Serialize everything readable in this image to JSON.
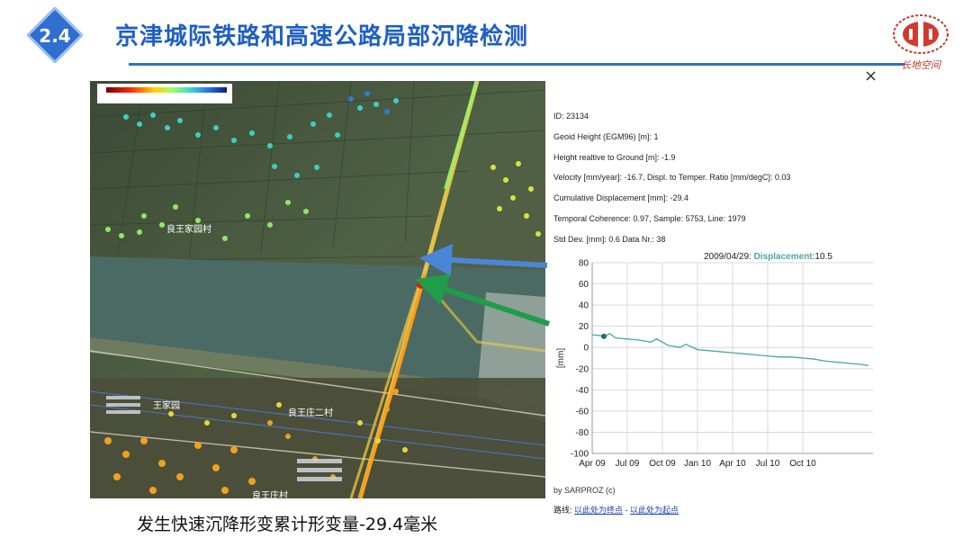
{
  "slide": {
    "section_number": "2.4",
    "title": "京津城际铁路和高速公路局部沉降检测",
    "logo_text": "长地空间",
    "caption": "发生快速沉降形变累计形变量-29.4毫米",
    "colors": {
      "title": "#1f5fc4",
      "badge": "#2e6fd0",
      "rule": "#2e6fd0",
      "arrow_blue": "#4a86d8",
      "arrow_green": "#1e9e4a",
      "curve": "#4aa6a6"
    }
  },
  "map": {
    "labels": [
      "良王家园村",
      "王家园",
      "良王庄二村",
      "良王庄村"
    ]
  },
  "popup": {
    "close_label": "×",
    "info_lines": [
      "ID: 23134",
      "Geoid Height (EGM96) [m]: 1",
      "Height realtive to Ground [m]: -1.9",
      "Velocity [mm/year]: -16.7, Displ. to Temper. Ratio [mm/degC]: 0.03",
      "Cumulative Displacement [mm]: -29.4",
      "Temporal Coherence: 0.97, Sample: 5753, Line: 1979",
      "Std Dev. [mm]: 0.6 Data Nr.: 38"
    ],
    "source_label": "by SARPROZ (c)",
    "route": {
      "prefix": "路线:",
      "link_end": "以此处为终点",
      "separator": " - ",
      "link_start": "以此处为起点"
    }
  },
  "chart_data": {
    "type": "line",
    "header_date": "2009/04/29: ",
    "header_label": "Displacement",
    "header_value": "10.5",
    "ylabel": "[mm]",
    "ylim": [
      -100,
      80
    ],
    "yticks": [
      80,
      60,
      40,
      20,
      0,
      -20,
      -40,
      -60,
      -80,
      -100
    ],
    "xlim": [
      0,
      24
    ],
    "xticks": [
      {
        "x": 0,
        "label": "Apr 09"
      },
      {
        "x": 3,
        "label": "Jul 09"
      },
      {
        "x": 6,
        "label": "Oct 09"
      },
      {
        "x": 9,
        "label": "Jan 10"
      },
      {
        "x": 12,
        "label": "Apr 10"
      },
      {
        "x": 15,
        "label": "Jul 10"
      },
      {
        "x": 18,
        "label": "Oct 10"
      }
    ],
    "grid": true,
    "highlight_index": 2,
    "series": [
      {
        "x": [
          0,
          0.5,
          1.0,
          1.5,
          2.0,
          3.0,
          4.0,
          5.0,
          5.5,
          6.5,
          7.0,
          7.5,
          8.0,
          9.0,
          10.0,
          12.0,
          13.0,
          14.0,
          15.0,
          16.0,
          17.0,
          18.0,
          19.0,
          20.0,
          21.0,
          22.0,
          23.0,
          23.6
        ],
        "y": [
          12,
          11.5,
          10.5,
          13,
          9,
          8,
          7,
          5,
          8,
          2,
          1,
          0,
          3,
          -2,
          -3,
          -5,
          -6,
          -7,
          -8,
          -9,
          -9,
          -10,
          -11,
          -13,
          -14,
          -15,
          -16,
          -17
        ]
      }
    ]
  }
}
